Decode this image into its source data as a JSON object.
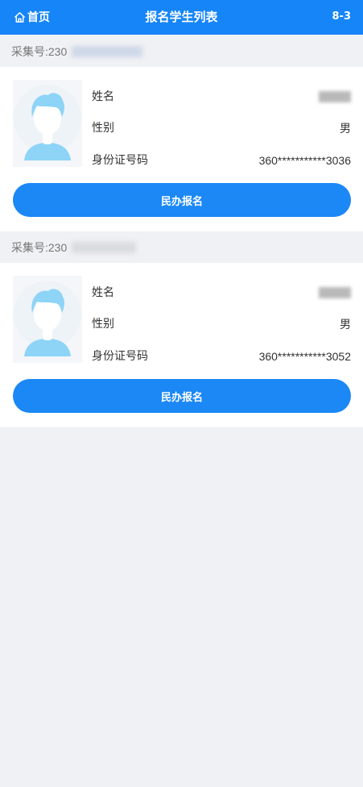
{
  "header": {
    "home_label": "首页",
    "title": "报名学生列表",
    "code": "8-3",
    "background": "#1685f8"
  },
  "students": [
    {
      "collect_label": "采集号:230",
      "fields": {
        "name_label": "姓名",
        "gender_label": "性别",
        "gender_value": "男",
        "id_label": "身份证号码",
        "id_value": "360***********3036"
      },
      "button_label": "民办报名"
    },
    {
      "collect_label": "采集号:230",
      "fields": {
        "name_label": "姓名",
        "gender_label": "性别",
        "gender_value": "男",
        "id_label": "身份证号码",
        "id_value": "360***********3052"
      },
      "button_label": "民办报名"
    }
  ],
  "colors": {
    "accent": "#1b88f5",
    "page_background": "#f0f1f4"
  }
}
